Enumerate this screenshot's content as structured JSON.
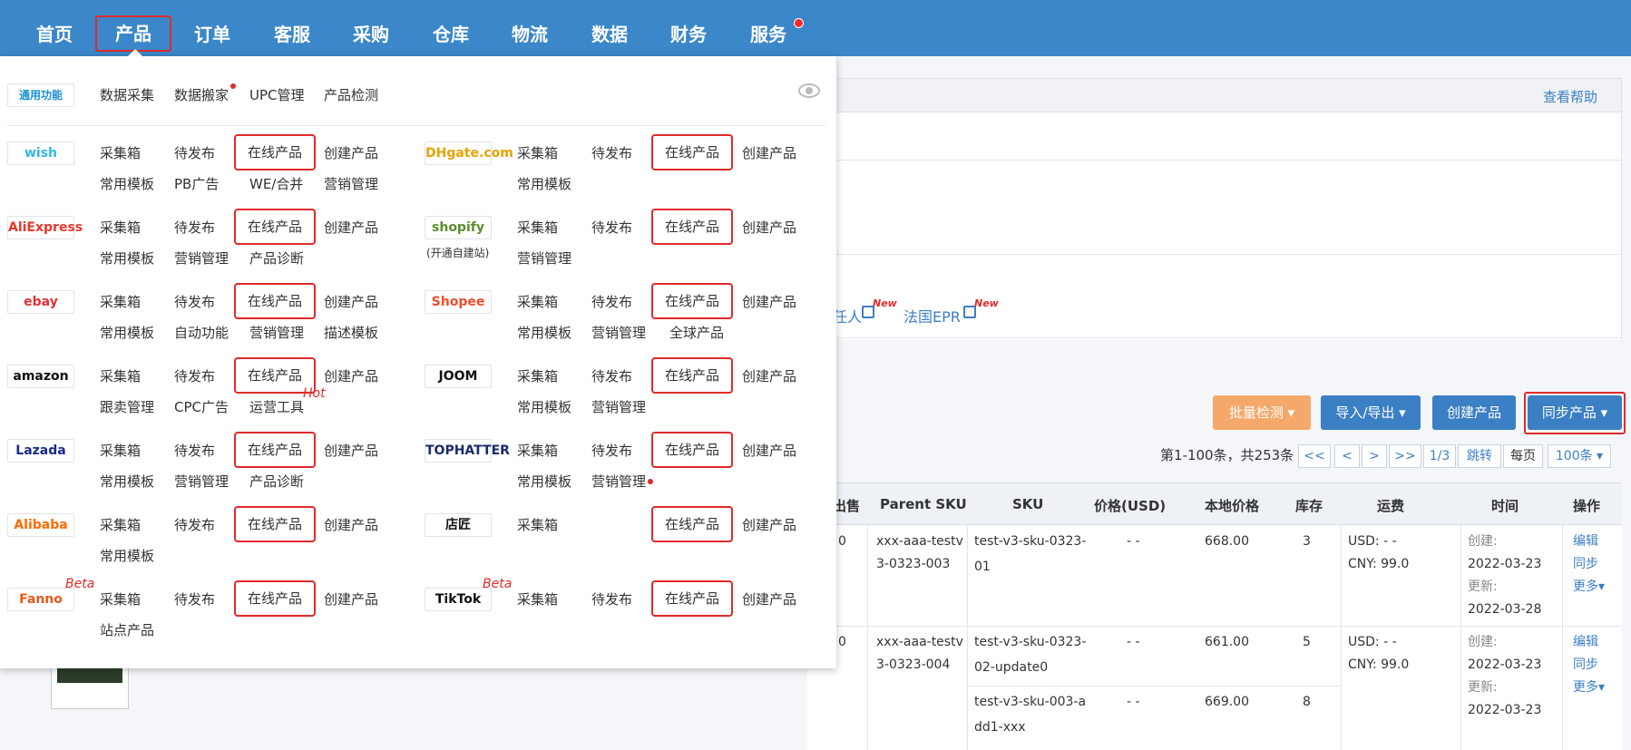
{
  "topnav": {
    "items": [
      {
        "label": "首页"
      },
      {
        "label": "产品"
      },
      {
        "label": "订单"
      },
      {
        "label": "客服"
      },
      {
        "label": "采购"
      },
      {
        "label": "仓库"
      },
      {
        "label": "物流"
      },
      {
        "label": "数据"
      },
      {
        "label": "财务"
      },
      {
        "label": "服务"
      }
    ]
  },
  "dropdown": {
    "general": {
      "logo": "通用功能",
      "items": [
        "数据采集",
        "数据搬家",
        "UPC管理",
        "产品检测"
      ]
    },
    "platforms": [
      {
        "logo": "wish",
        "color": "#2fb7ec",
        "row1": [
          "采集箱",
          "待发布",
          "在线产品",
          "创建产品"
        ],
        "row2": [
          "常用模板",
          "PB广告",
          "WE/合并",
          "营销管理"
        ]
      },
      {
        "logo": "DHgate.com",
        "color": "#e8a200",
        "row1": [
          "采集箱",
          "待发布",
          "在线产品",
          "创建产品"
        ],
        "row2": [
          "常用模板"
        ]
      },
      {
        "logo": "AliExpress",
        "color": "#e6392d",
        "row1": [
          "采集箱",
          "待发布",
          "在线产品",
          "创建产品"
        ],
        "row2": [
          "常用模板",
          "营销管理",
          "产品诊断"
        ]
      },
      {
        "logo": "shopify",
        "sub": "(开通自建站)",
        "color": "#5b8f2b",
        "row1": [
          "采集箱",
          "待发布",
          "在线产品",
          "创建产品"
        ],
        "row2": [
          "营销管理"
        ]
      },
      {
        "logo": "ebay",
        "color": "#e43137",
        "row1": [
          "采集箱",
          "待发布",
          "在线产品",
          "创建产品"
        ],
        "row2": [
          "常用模板",
          "自动功能",
          "营销管理",
          "描述模板"
        ]
      },
      {
        "logo": "Shopee",
        "color": "#ee4d2d",
        "row1": [
          "采集箱",
          "待发布",
          "在线产品",
          "创建产品"
        ],
        "row2": [
          "常用模板",
          "营销管理",
          "全球产品"
        ]
      },
      {
        "logo": "amazon",
        "color": "#111111",
        "row1": [
          "采集箱",
          "待发布",
          "在线产品",
          "创建产品"
        ],
        "row2": [
          "跟卖管理",
          "CPC广告",
          "运营工具"
        ],
        "hot": "Hot"
      },
      {
        "logo": "JOOM",
        "color": "#111111",
        "row1": [
          "采集箱",
          "待发布",
          "在线产品",
          "创建产品"
        ],
        "row2": [
          "常用模板",
          "营销管理"
        ]
      },
      {
        "logo": "Lazada",
        "color": "#1a2a8c",
        "row1": [
          "采集箱",
          "待发布",
          "在线产品",
          "创建产品"
        ],
        "row2": [
          "常用模板",
          "营销管理",
          "产品诊断"
        ]
      },
      {
        "logo": "TOPHATTER",
        "color": "#1a2a6c",
        "row1": [
          "采集箱",
          "待发布",
          "在线产品",
          "创建产品"
        ],
        "row2": [
          "常用模板",
          "营销管理"
        ]
      },
      {
        "logo": "Alibaba",
        "color": "#ff6a00",
        "row1": [
          "采集箱",
          "待发布",
          "在线产品",
          "创建产品"
        ],
        "row2": [
          "常用模板"
        ]
      },
      {
        "logo": "店匠",
        "color": "#111111",
        "row1": [
          "采集箱",
          "在线产品",
          "创建产品"
        ],
        "row2": []
      },
      {
        "logo": "Fanno",
        "color": "#e8591a",
        "beta": "Beta",
        "row1": [
          "采集箱",
          "待发布",
          "在线产品",
          "创建产品"
        ],
        "row2": [
          "站点产品"
        ]
      },
      {
        "logo": "TikTok",
        "color": "#111111",
        "beta": "Beta",
        "row1": [
          "采集箱",
          "待发布",
          "在线产品",
          "创建产品"
        ],
        "row2": []
      }
    ]
  },
  "background": {
    "help_link": "查看帮助",
    "links": [
      {
        "label": "任人",
        "new": "New"
      },
      {
        "label": "法国EPR",
        "new": "New"
      }
    ],
    "buttons": {
      "batch_check": "批量检测 ▾",
      "import_export": "导入/导出 ▾",
      "create_product": "创建产品",
      "sync_product": "同步产品 ▾"
    },
    "pager": {
      "summary": "第1-100条，共253条",
      "first": "<<",
      "prev": "<",
      "next": ">",
      "last": ">>",
      "page": "1/3",
      "jump": "跳转",
      "per_page_label": "每页",
      "per_page": "100条 ▾"
    },
    "table": {
      "headers": [
        "出售",
        "Parent SKU",
        "SKU",
        "价格(USD)",
        "本地价格",
        "库存",
        "运费",
        "时间",
        "操作"
      ],
      "rows": [
        {
          "sold": "0",
          "parent_sku_1": "xxx-aaa-testv",
          "parent_sku_2": "3-0323-003",
          "sku_1": "test-v3-sku-0323-",
          "sku_2": "01",
          "price": "- -",
          "local_price": "668.00",
          "stock": "3",
          "ship_usd": "USD:  - -",
          "ship_cny": "CNY:  99.0",
          "created_label": "创建:",
          "created": "2022-03-23",
          "updated_label": "更新:",
          "updated": "2022-03-28",
          "actions": [
            "编辑",
            "同步",
            "更多▾"
          ]
        },
        {
          "sold": "0",
          "parent_sku_1": "xxx-aaa-testv",
          "parent_sku_2": "3-0323-004",
          "sku_1": "test-v3-sku-0323-",
          "sku_2": "02-update0",
          "price": "- -",
          "local_price": "661.00",
          "stock": "5",
          "ship_usd": "USD:  - -",
          "ship_cny": "CNY:  99.0",
          "created_label": "创建:",
          "created": "2022-03-23",
          "updated_label": "更新:",
          "updated": "2022-03-23",
          "actions": [
            "编辑",
            "同步",
            "更多▾"
          ],
          "sub_sku_1": "test-v3-sku-003-a",
          "sub_sku_2": "dd1-xxx",
          "sub_price": "- -",
          "sub_local_price": "669.00",
          "sub_stock": "8"
        }
      ]
    },
    "thumb_text": "test"
  }
}
